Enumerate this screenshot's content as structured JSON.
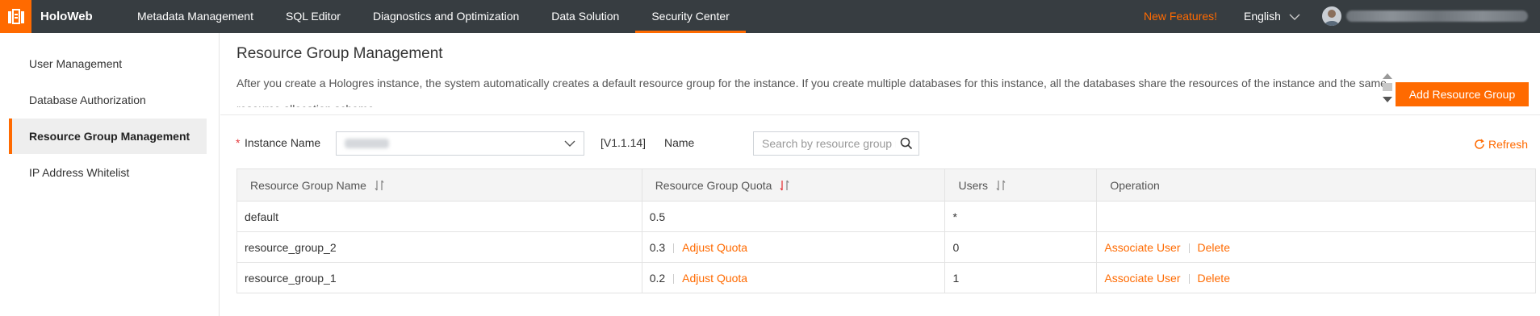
{
  "header": {
    "brand": "HoloWeb",
    "nav": [
      {
        "label": "Metadata Management"
      },
      {
        "label": "SQL Editor"
      },
      {
        "label": "Diagnostics and Optimization"
      },
      {
        "label": "Data Solution"
      },
      {
        "label": "Security Center",
        "active": true
      }
    ],
    "new_features": "New Features!",
    "language": "English"
  },
  "sidebar": {
    "items": [
      {
        "label": "User Management"
      },
      {
        "label": "Database Authorization"
      },
      {
        "label": "Resource Group Management",
        "active": true
      },
      {
        "label": "IP Address Whitelist"
      }
    ]
  },
  "main": {
    "title": "Resource Group Management",
    "description": "After you create a Hologres instance, the system automatically creates a default resource group for the instance. If you create multiple databases for this instance, all the databases share the resources of the instance and the same resource allocation scheme.",
    "add_button": "Add Resource Group",
    "filters": {
      "instance_label": "Instance Name",
      "required_mark": "*",
      "version": "[V1.1.14]",
      "name_label": "Name",
      "search_placeholder": "Search by resource group name"
    },
    "refresh": "Refresh",
    "table": {
      "columns": [
        "Resource Group Name",
        "Resource Group Quota",
        "Users",
        "Operation"
      ],
      "rows": [
        {
          "name": "default",
          "quota": "0.5",
          "users": "*",
          "adjust": "",
          "associate": "",
          "delete": ""
        },
        {
          "name": "resource_group_2",
          "quota": "0.3",
          "users": "0",
          "adjust": "Adjust Quota",
          "associate": "Associate User",
          "delete": "Delete"
        },
        {
          "name": "resource_group_1",
          "quota": "0.2",
          "users": "1",
          "adjust": "Adjust Quota",
          "associate": "Associate User",
          "delete": "Delete"
        }
      ]
    }
  },
  "colors": {
    "accent": "#ff6a00",
    "topbar": "#373d41",
    "required": "#e4393c"
  }
}
